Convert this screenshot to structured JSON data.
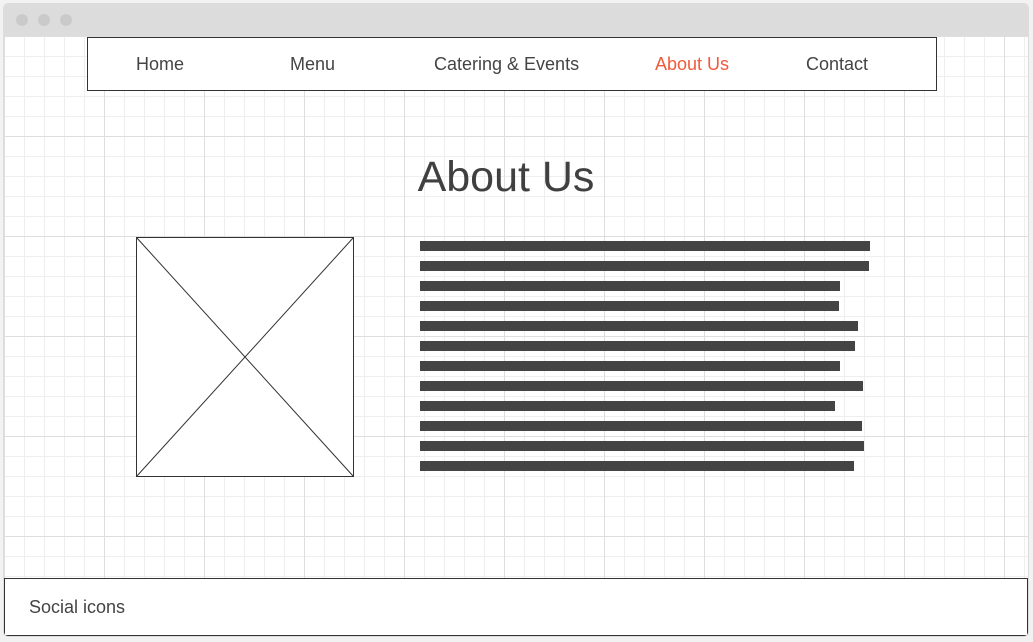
{
  "nav": {
    "items": [
      {
        "label": "Home",
        "active": false
      },
      {
        "label": "Menu",
        "active": false
      },
      {
        "label": "Catering & Events",
        "active": false
      },
      {
        "label": "About Us",
        "active": true
      },
      {
        "label": "Contact",
        "active": false
      }
    ],
    "active_color": "#f05a3c",
    "text_color": "#444444"
  },
  "main": {
    "title": "About Us",
    "image": {
      "icon": "image-placeholder-icon"
    },
    "text_lines_count": 12
  },
  "footer": {
    "label": "Social icons"
  },
  "colors": {
    "window_chrome": "#dcdcdc",
    "text_bar": "#444444",
    "border": "#333333"
  }
}
